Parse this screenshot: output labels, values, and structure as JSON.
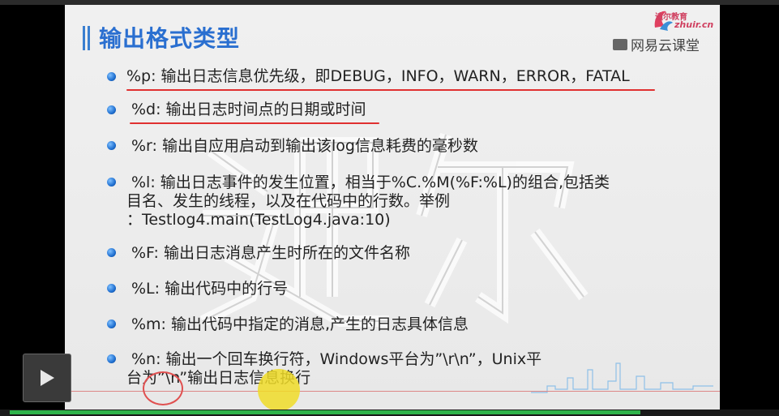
{
  "slide": {
    "title": "输出格式类型",
    "brand_label": "网易云课堂",
    "logo_line1": "追尔教育",
    "logo_line2": "zhuir.cn",
    "items": [
      {
        "text": "%p: 输出日志信息优先级，即DEBUG，INFO，WARN，ERROR，FATAL"
      },
      {
        "text": "%d: 输出日志时间点的日期或时间"
      },
      {
        "text": "%r: 输出自应用启动到输出该log信息耗费的毫秒数"
      },
      {
        "line1": "%l: 输出日志事件的发生位置，相当于%C.%M(%F:%L)的组合,包括类",
        "line2": "目名、发生的线程，以及在代码中的行数。举例",
        "line3": "：Testlog4.main(TestLog4.java:10)"
      },
      {
        "text": "%F: 输出日志消息产生时所在的文件名称"
      },
      {
        "text": "%L: 输出代码中的行号"
      },
      {
        "text": "%m: 输出代码中指定的消息,产生的日志具体信息"
      },
      {
        "line1": "%n: 输出一个回车换行符，Windows平台为”\\r\\n”，Unix平",
        "line2": "台为”\\n”输出日志信息换行"
      }
    ]
  },
  "player": {
    "progress": 0.82,
    "accent_color": "#2fb34a"
  }
}
